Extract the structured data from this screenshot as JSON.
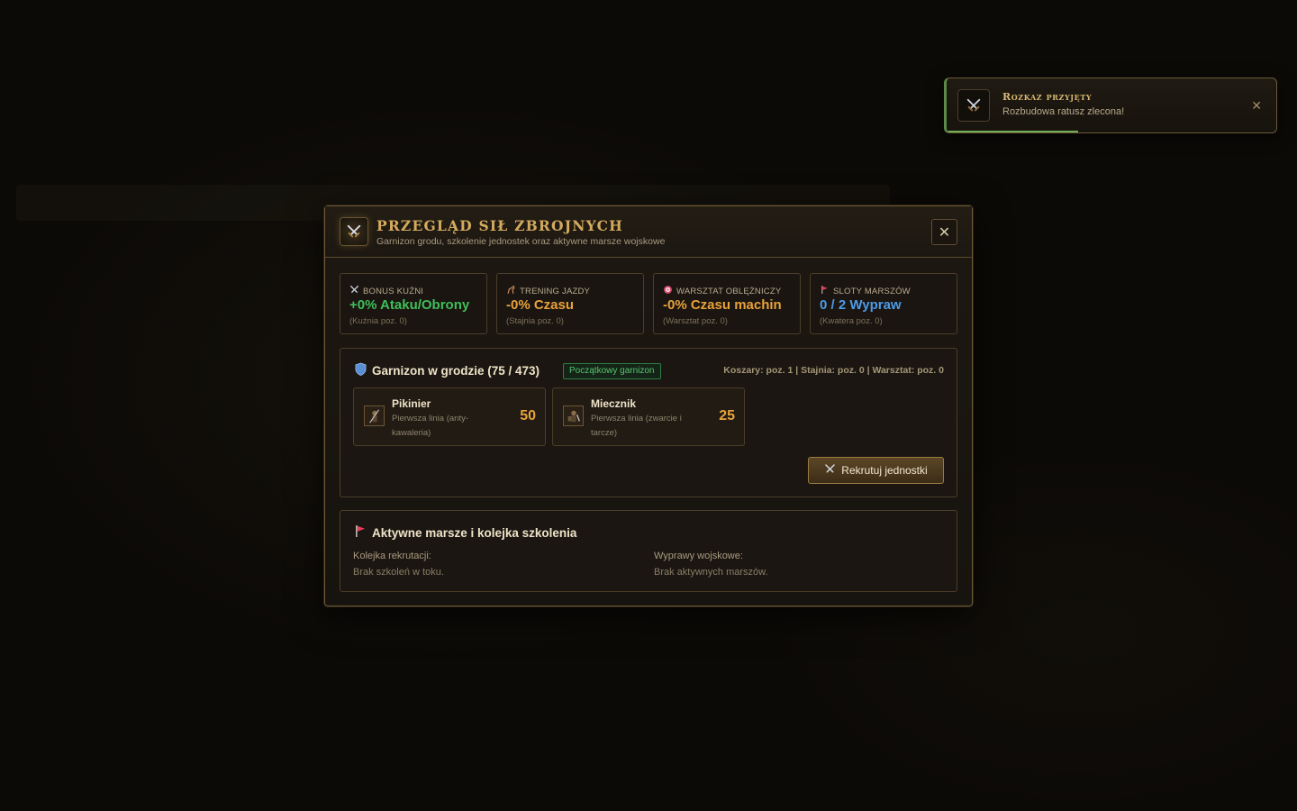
{
  "toast": {
    "title": "Rozkaz przyjęty",
    "message": "Rozbudowa ratusz zlecona!",
    "close": "✕",
    "icon": "crossed-swords-icon",
    "progress": 0.4
  },
  "modal": {
    "title": "PRZEGLĄD SIŁ ZBROJNYCH",
    "subtitle": "Garnizon grodu, szkolenie jednostek oraz aktywne marsze wojskowe",
    "close": "✕",
    "icon": "crossed-swords-icon"
  },
  "stats": [
    {
      "label": "Bonus kuźni",
      "value": "+0% Ataku/Obrony",
      "sub": "(Kuźnia poz. 0)",
      "color": "#3fbf5a",
      "icon": "crossed-swords-icon"
    },
    {
      "label": "Trening jazdy",
      "value": "-0% Czasu",
      "sub": "(Stajnia poz. 0)",
      "color": "#e8a23a",
      "icon": "horse-icon"
    },
    {
      "label": "Warsztat oblężniczy",
      "value": "-0% Czasu machin",
      "sub": "(Warsztat poz. 0)",
      "color": "#e8a23a",
      "icon": "target-icon"
    },
    {
      "label": "Sloty marszów",
      "value": "0 / 2 Wypraw",
      "sub": "(Kwatera poz. 0)",
      "color": "#4d9be8",
      "icon": "flag-icon"
    }
  ],
  "garrison": {
    "title": "Garnizon w grodzie (75 / 473)",
    "badge": "Początkowy garnizon",
    "buildings": "Koszary: poz. 1 | Stajnia: poz. 0 | Warsztat: poz. 0",
    "units": [
      {
        "name": "Pikinier",
        "desc": "Pierwsza linia (anty-kawaleria)",
        "count": "50"
      },
      {
        "name": "Miecznik",
        "desc": "Pierwsza linia (zwarcie i tarcze)",
        "count": "25"
      }
    ],
    "recruit_label": "Rekrutuj jednostki"
  },
  "marches": {
    "title": "Aktywne marsze i kolejka szkolenia",
    "queue_label": "Kolejka rekrutacji:",
    "queue_text": "Brak szkoleń w toku.",
    "expeditions_label": "Wyprawy wojskowe:",
    "expeditions_text": "Brak aktywnych marszów."
  },
  "colors": {
    "accent_gold": "#d4aa5e",
    "green": "#3fbf5a",
    "orange": "#e8a23a",
    "blue": "#4d9be8"
  }
}
